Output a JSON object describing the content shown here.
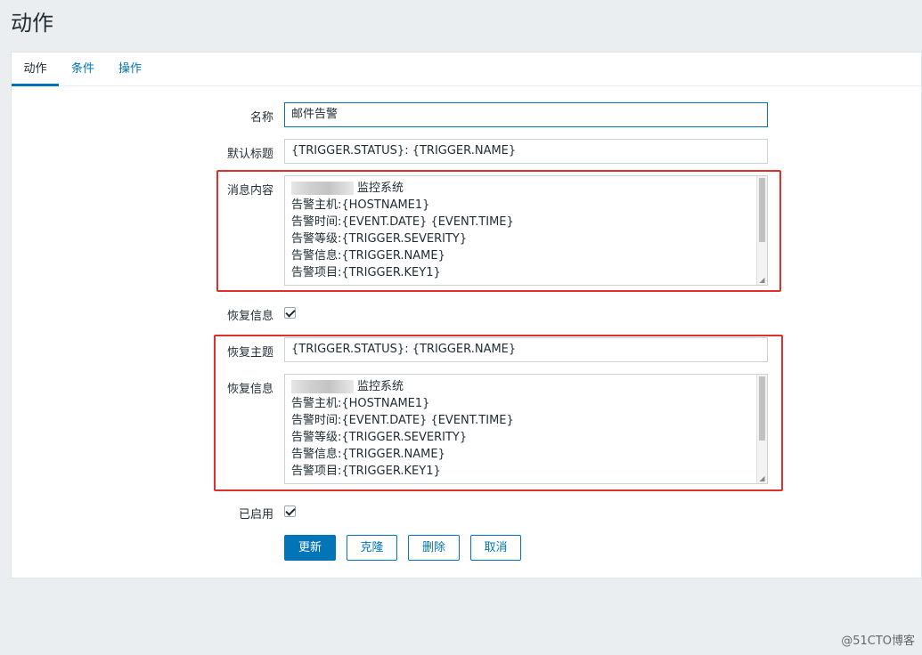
{
  "page": {
    "title": "动作"
  },
  "tabs": [
    {
      "label": "动作",
      "active": true
    },
    {
      "label": "条件",
      "active": false
    },
    {
      "label": "操作",
      "active": false
    }
  ],
  "form": {
    "name": {
      "label": "名称",
      "value": "邮件告警"
    },
    "default_subject": {
      "label": "默认标题",
      "value": "{TRIGGER.STATUS}: {TRIGGER.NAME}"
    },
    "message": {
      "label": "消息内容",
      "lines": [
        "监控系统",
        "告警主机:{HOSTNAME1}",
        "告警时间:{EVENT.DATE} {EVENT.TIME}",
        "告警等级:{TRIGGER.SEVERITY}",
        "告警信息:{TRIGGER.NAME}",
        "告警项目:{TRIGGER.KEY1}"
      ]
    },
    "recovery_enabled": {
      "label": "恢复信息",
      "checked": true
    },
    "recovery_subject": {
      "label": "恢复主题",
      "value": "{TRIGGER.STATUS}: {TRIGGER.NAME}"
    },
    "recovery_message": {
      "label": "恢复信息",
      "lines": [
        "监控系统",
        "告警主机:{HOSTNAME1}",
        "告警时间:{EVENT.DATE} {EVENT.TIME}",
        "告警等级:{TRIGGER.SEVERITY}",
        "告警信息:{TRIGGER.NAME}",
        "告警项目:{TRIGGER.KEY1}"
      ]
    },
    "enabled": {
      "label": "已启用",
      "checked": true
    }
  },
  "buttons": {
    "update": "更新",
    "clone": "克隆",
    "delete": "删除",
    "cancel": "取消"
  },
  "watermark": "@51CTO博客",
  "colors": {
    "accent": "#0275b8",
    "highlight": "#e0302c",
    "background": "#ebeef0"
  }
}
